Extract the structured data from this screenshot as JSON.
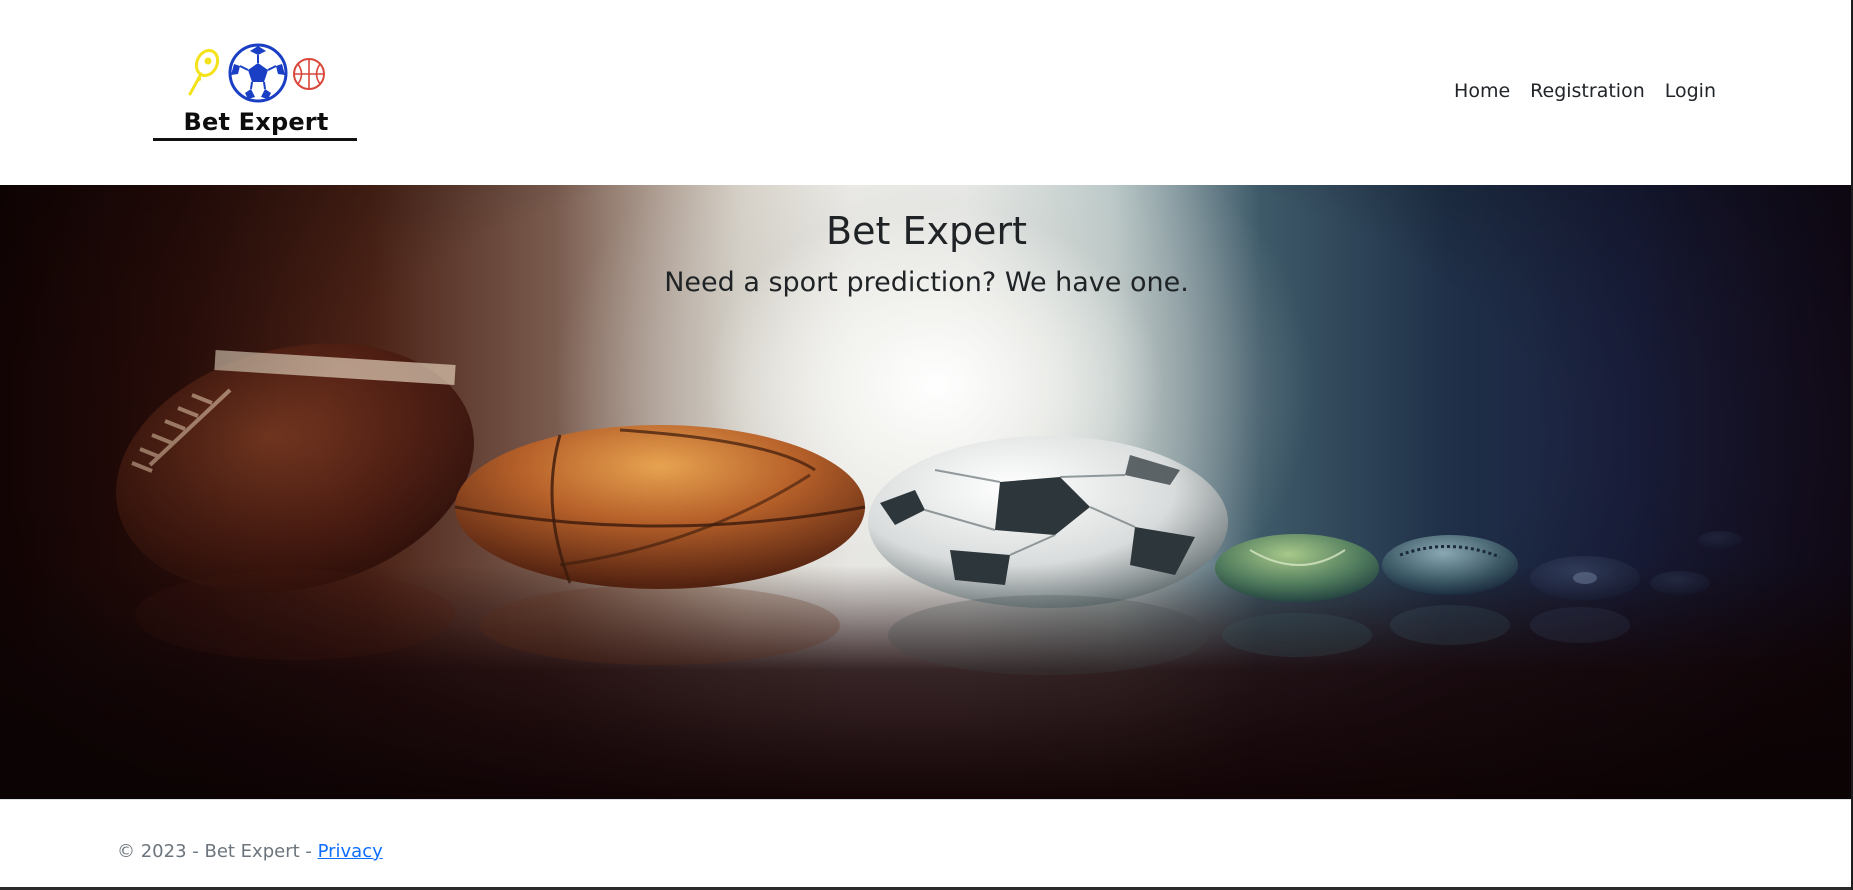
{
  "header": {
    "logo_text": "Bet Expert",
    "logo_icons": [
      "tennis-icon",
      "soccer-ball-icon",
      "basketball-icon"
    ],
    "nav": [
      {
        "label": "Home"
      },
      {
        "label": "Registration"
      },
      {
        "label": "Login"
      }
    ]
  },
  "hero": {
    "title": "Bet Expert",
    "subtitle": "Need a sport prediction? We have one.",
    "background_image": "sports-balls-banner"
  },
  "footer": {
    "copyright": "© 2023 - Bet Expert - ",
    "privacy_link": "Privacy"
  },
  "colors": {
    "link": "#0d6efd",
    "footer_text": "#6c757d",
    "tennis_icon": "#f4e21a",
    "soccer_icon": "#1a3fc4",
    "basketball_icon": "#d9473a"
  }
}
